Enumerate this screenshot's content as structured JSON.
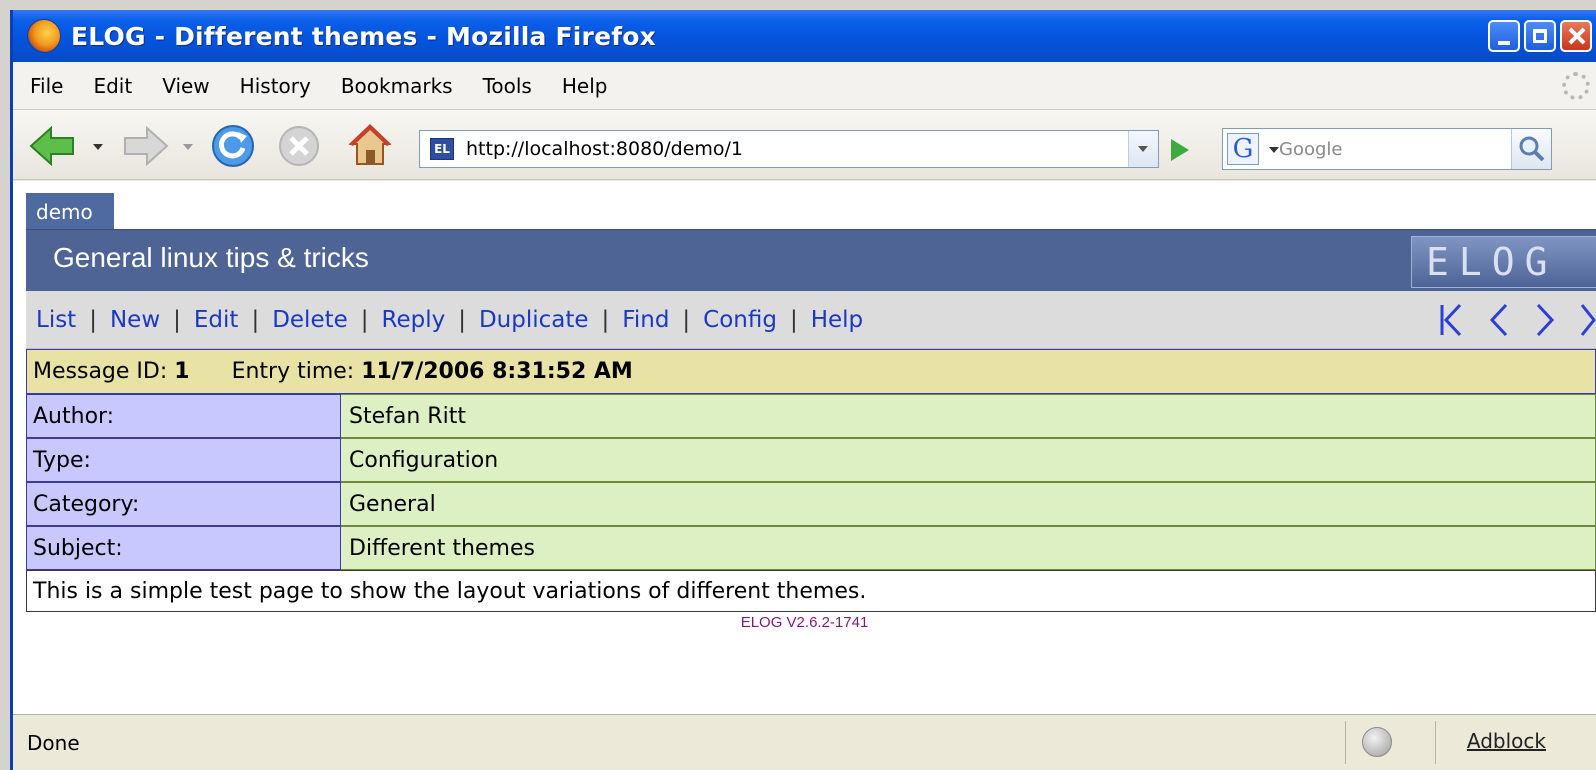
{
  "window": {
    "title": "ELOG - Different themes - Mozilla Firefox"
  },
  "menu": [
    "File",
    "Edit",
    "View",
    "History",
    "Bookmarks",
    "Tools",
    "Help"
  ],
  "nav": {
    "url": "http://localhost:8080/demo/1",
    "search_placeholder": "Google",
    "icons": [
      "back-arrow-icon",
      "forward-arrow-icon",
      "reload-icon",
      "stop-icon",
      "home-icon",
      "site-icon",
      "go-icon",
      "google-icon",
      "search-icon"
    ]
  },
  "elog": {
    "logbook_tab": "demo",
    "title": "General linux tips & tricks",
    "logo_text": "ELOG",
    "commands": [
      "List",
      "New",
      "Edit",
      "Delete",
      "Reply",
      "Duplicate",
      "Find",
      "Config",
      "Help"
    ],
    "message_id_label": "Message ID:",
    "message_id": "1",
    "entry_time_label": "Entry time:",
    "entry_time": "11/7/2006 8:31:52 AM",
    "attributes": [
      {
        "name": "Author:",
        "value": "Stefan Ritt"
      },
      {
        "name": "Type:",
        "value": "Configuration"
      },
      {
        "name": "Category:",
        "value": "General"
      },
      {
        "name": "Subject:",
        "value": "Different themes"
      }
    ],
    "body": "This is a simple test page to show the layout variations of different themes.",
    "version": "ELOG V2.6.2-1741"
  },
  "status": {
    "text": "Done",
    "adblock": "Adblock"
  },
  "colors": {
    "header": "#4d6494",
    "link": "#1a38c4",
    "attr_name_bg": "#c8c8ff",
    "attr_value_bg": "#dcf0c4",
    "attr_head_bg": "#e8e3a5"
  }
}
